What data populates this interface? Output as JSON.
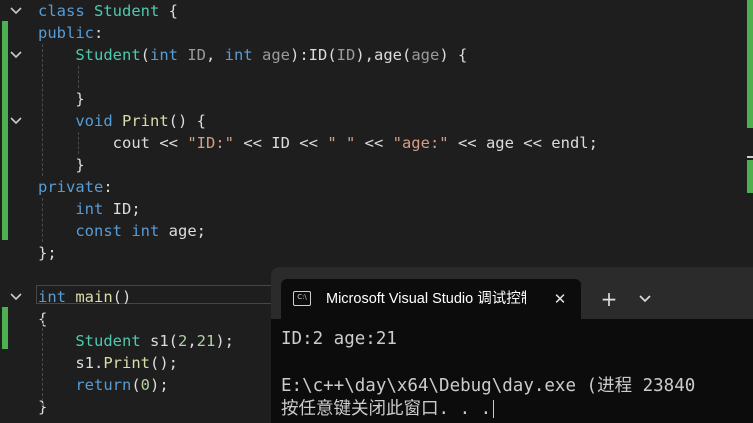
{
  "editor": {
    "lines": [
      {
        "tokens": [
          {
            "t": "class ",
            "c": "kw"
          },
          {
            "t": "Student",
            "c": "ty"
          },
          {
            "t": " {",
            "c": ""
          }
        ]
      },
      {
        "tokens": [
          {
            "t": "public",
            "c": "kw"
          },
          {
            "t": ":",
            "c": ""
          }
        ]
      },
      {
        "tokens": [
          {
            "t": "    ",
            "c": ""
          },
          {
            "t": "Student",
            "c": "ty"
          },
          {
            "t": "(",
            "c": ""
          },
          {
            "t": "int",
            "c": "kw"
          },
          {
            "t": " ID",
            "c": "pm"
          },
          {
            "t": ", ",
            "c": ""
          },
          {
            "t": "int",
            "c": "kw"
          },
          {
            "t": " age",
            "c": "pm"
          },
          {
            "t": "):ID(",
            "c": ""
          },
          {
            "t": "ID",
            "c": "pm"
          },
          {
            "t": "),age(",
            "c": ""
          },
          {
            "t": "age",
            "c": "pm"
          },
          {
            "t": ") {",
            "c": ""
          }
        ]
      },
      {
        "tokens": []
      },
      {
        "tokens": [
          {
            "t": "    }",
            "c": ""
          }
        ]
      },
      {
        "tokens": [
          {
            "t": "    ",
            "c": ""
          },
          {
            "t": "void",
            "c": "kw"
          },
          {
            "t": " ",
            "c": ""
          },
          {
            "t": "Print",
            "c": "fn"
          },
          {
            "t": "() {",
            "c": ""
          }
        ]
      },
      {
        "tokens": [
          {
            "t": "        cout << ",
            "c": ""
          },
          {
            "t": "\"ID:\"",
            "c": "st"
          },
          {
            "t": " << ID << ",
            "c": ""
          },
          {
            "t": "\" \"",
            "c": "st"
          },
          {
            "t": " << ",
            "c": ""
          },
          {
            "t": "\"age:\"",
            "c": "st"
          },
          {
            "t": " << age << endl;",
            "c": ""
          }
        ]
      },
      {
        "tokens": [
          {
            "t": "    }",
            "c": ""
          }
        ]
      },
      {
        "tokens": [
          {
            "t": "private",
            "c": "kw"
          },
          {
            "t": ":",
            "c": ""
          }
        ]
      },
      {
        "tokens": [
          {
            "t": "    ",
            "c": ""
          },
          {
            "t": "int",
            "c": "kw"
          },
          {
            "t": " ID;",
            "c": ""
          }
        ]
      },
      {
        "tokens": [
          {
            "t": "    ",
            "c": ""
          },
          {
            "t": "const",
            "c": "kw"
          },
          {
            "t": " ",
            "c": ""
          },
          {
            "t": "int",
            "c": "kw"
          },
          {
            "t": " age;",
            "c": ""
          }
        ]
      },
      {
        "tokens": [
          {
            "t": "};",
            "c": ""
          }
        ]
      },
      {
        "tokens": []
      },
      {
        "tokens": [
          {
            "t": "int",
            "c": "kw"
          },
          {
            "t": " ",
            "c": ""
          },
          {
            "t": "main",
            "c": "fn"
          },
          {
            "t": "()",
            "c": ""
          }
        ]
      },
      {
        "tokens": [
          {
            "t": "{",
            "c": ""
          }
        ]
      },
      {
        "tokens": [
          {
            "t": "    ",
            "c": ""
          },
          {
            "t": "Student",
            "c": "ty"
          },
          {
            "t": " s1(",
            "c": ""
          },
          {
            "t": "2",
            "c": "nu"
          },
          {
            "t": ",",
            "c": ""
          },
          {
            "t": "21",
            "c": "nu"
          },
          {
            "t": ");",
            "c": ""
          }
        ]
      },
      {
        "tokens": [
          {
            "t": "    s1.",
            "c": ""
          },
          {
            "t": "Print",
            "c": "fn"
          },
          {
            "t": "();",
            "c": ""
          }
        ]
      },
      {
        "tokens": [
          {
            "t": "    ",
            "c": ""
          },
          {
            "t": "return",
            "c": "kw"
          },
          {
            "t": "(",
            "c": ""
          },
          {
            "t": "0",
            "c": "nu"
          },
          {
            "t": ");",
            "c": ""
          }
        ]
      },
      {
        "tokens": [
          {
            "t": "}",
            "c": ""
          }
        ]
      }
    ]
  },
  "terminal": {
    "tab_title": "Microsoft Visual Studio 调试控制台",
    "tab_icon_label": "C:\\",
    "close_glyph": "✕",
    "new_tab_glyph": "+",
    "output": {
      "line1": "ID:2 age:21",
      "line2": "",
      "line3": "E:\\c++\\day\\x64\\Debug\\day.exe (进程 23840",
      "line4": "按任意键关闭此窗口. . ."
    }
  },
  "colors": {
    "keyword": "#569cd6",
    "type": "#4ec9b0",
    "function": "#dcdcaa",
    "string": "#d69d85",
    "number": "#b5cea8",
    "change_bar": "#4caf50"
  }
}
